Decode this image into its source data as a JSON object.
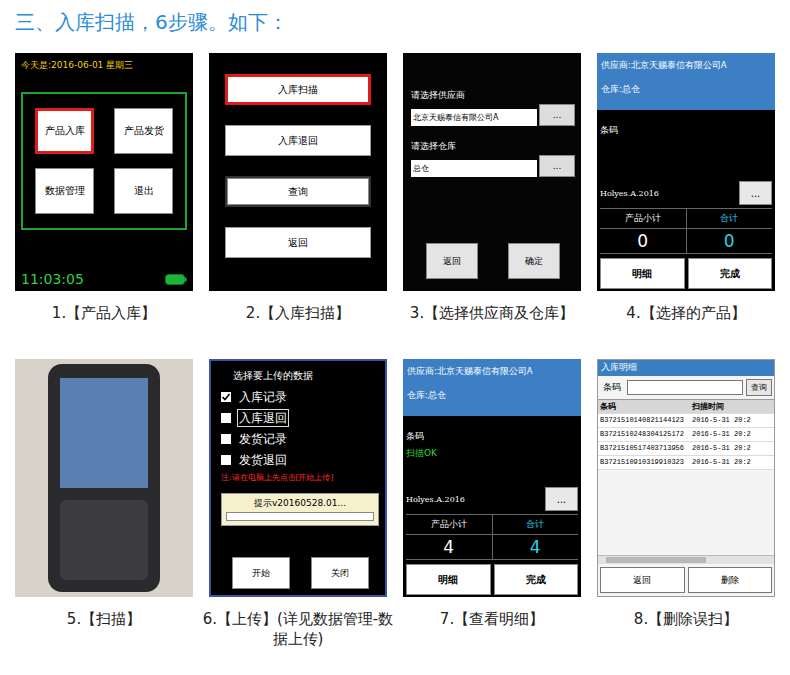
{
  "title": "三、入库扫描，6步骤。如下：",
  "steps": [
    {
      "kind": "home",
      "caption": "1.【产品入库】",
      "date": "今天是:2016-06-01 星期三",
      "time": "11:03:05",
      "buttons": [
        {
          "label": "产品入库",
          "selected": true
        },
        {
          "label": "产品发货",
          "selected": false
        },
        {
          "label": "数据管理",
          "selected": false
        },
        {
          "label": "退出",
          "selected": false
        }
      ]
    },
    {
      "kind": "menu",
      "caption": "2.【入库扫描】",
      "buttons": [
        {
          "label": "入库扫描",
          "selected": true,
          "focused": false
        },
        {
          "label": "入库退回",
          "selected": false,
          "focused": false
        },
        {
          "label": "查询",
          "selected": false,
          "focused": true
        },
        {
          "label": "返回",
          "selected": false,
          "focused": false
        }
      ]
    },
    {
      "kind": "select",
      "caption": "3.【选择供应商及仓库】",
      "fields": [
        {
          "label": "请选择供应商",
          "value": "北京天赐泰信有限公司A",
          "button": "..."
        },
        {
          "label": "请选择仓库",
          "value": "总仓",
          "button": "..."
        }
      ],
      "buttons": [
        "返回",
        "确定"
      ]
    },
    {
      "kind": "scan",
      "caption": "4.【选择的产品】",
      "supplier": "供应商:北京天赐泰信有限公司A",
      "warehouse": "仓库:总仓",
      "barcode_label": "条码",
      "status": "",
      "product": "Holyes.A.2016",
      "product_button": "...",
      "columns": [
        {
          "label": "产品小计",
          "value": "0",
          "color": "#ffffff"
        },
        {
          "label": "合计",
          "value": "0",
          "color": "#2ad4e8"
        }
      ],
      "buttons": [
        "明细",
        "完成"
      ]
    },
    {
      "kind": "photo",
      "caption": "5.【扫描】"
    },
    {
      "kind": "upload",
      "caption": "6.【上传】(详见数据管理-数据上传)",
      "heading": "选择要上传的数据",
      "options": [
        {
          "label": "入库记录",
          "checked": true,
          "focused": false
        },
        {
          "label": "入库退回",
          "checked": false,
          "focused": true
        },
        {
          "label": "发货记录",
          "checked": false,
          "focused": false
        },
        {
          "label": "发货退回",
          "checked": false,
          "focused": false
        }
      ],
      "note": "注:请在电脑上先点击[开始上传]",
      "progress": {
        "label": "提示v20160528.01...",
        "level": 0
      },
      "buttons": [
        "开始",
        "关闭"
      ]
    },
    {
      "kind": "scan",
      "caption": "7.【查看明细】",
      "supplier": "供应商:北京天赐泰信有限公司A",
      "warehouse": "仓库:总仓",
      "barcode_label": "条码",
      "status": "扫描OK",
      "product": "Holyes.A.2016",
      "product_button": "...",
      "columns": [
        {
          "label": "产品小计",
          "value": "4",
          "color": "#ffffff"
        },
        {
          "label": "合计",
          "value": "4",
          "color": "#2ad4e8"
        }
      ],
      "buttons": [
        "明细",
        "完成"
      ]
    },
    {
      "kind": "detail",
      "caption": "8.【删除误扫】",
      "header": "入库明细",
      "search_label": "条码",
      "search_value": "",
      "search_button": "查询",
      "columns": [
        "条码",
        "扫描时间"
      ],
      "rows": [
        [
          "B3721510140821144123",
          "2016-5-31 20:2"
        ],
        [
          "B3721510248304125172",
          "2016-5-31 20:2"
        ],
        [
          "B3721510517403713956",
          "2016-5-31 20:2"
        ],
        [
          "B3721510910319910323",
          "2016-5-31 20:2"
        ]
      ],
      "buttons": [
        "返回",
        "删除"
      ]
    }
  ]
}
